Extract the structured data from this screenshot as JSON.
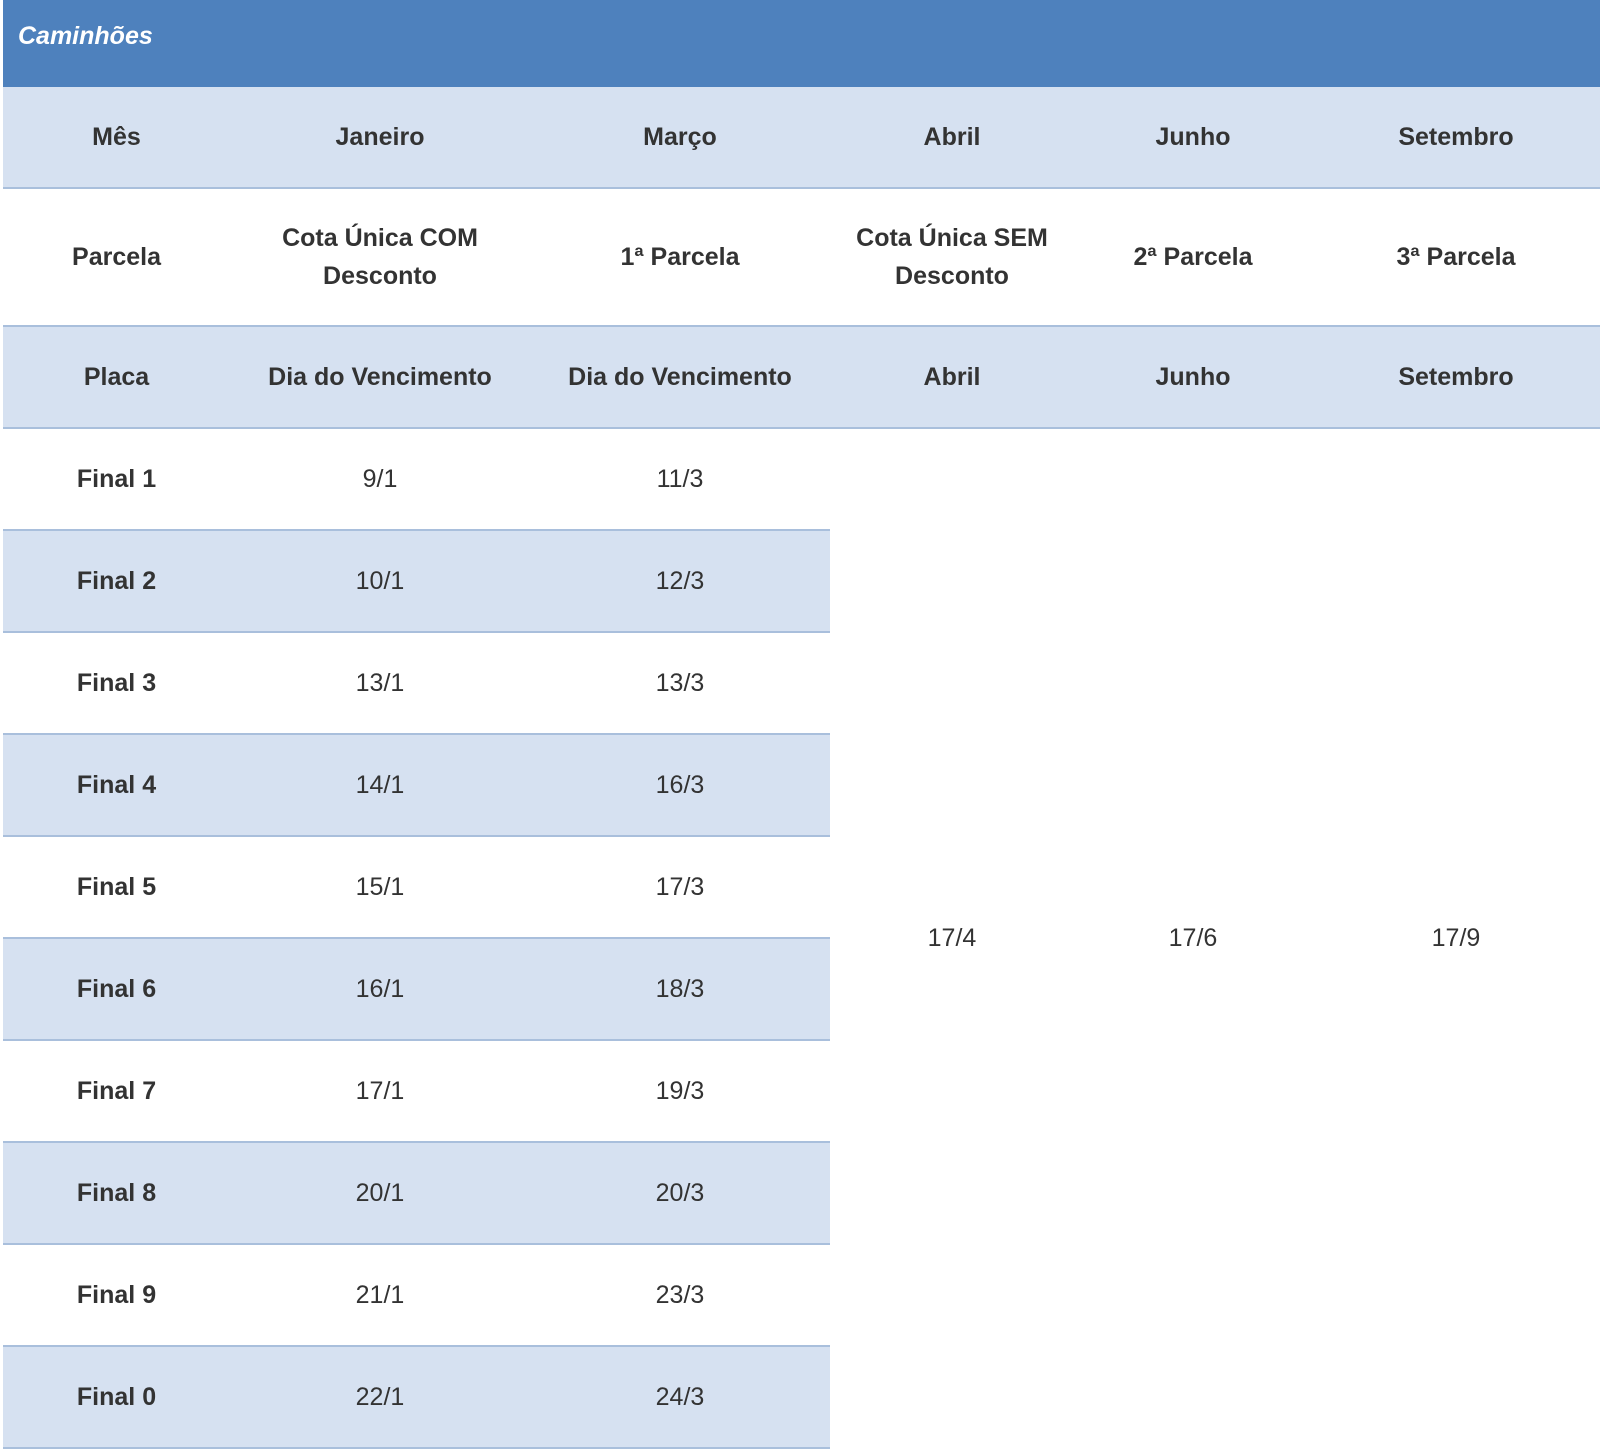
{
  "title": "Caminhões",
  "header_month": [
    "Mês",
    "Janeiro",
    "Março",
    "Abril",
    "Junho",
    "Setembro"
  ],
  "header_parcela": [
    "Parcela",
    "Cota Única COM Desconto",
    "1ª Parcela",
    "Cota Única SEM Desconto",
    "2ª Parcela",
    "3ª Parcela"
  ],
  "header_placa": [
    "Placa",
    "Dia do Vencimento",
    "Dia do Vencimento",
    "Abril",
    "Junho",
    "Setembro"
  ],
  "rows": [
    {
      "placa": "Final 1",
      "janeiro": "9/1",
      "marco": "11/3"
    },
    {
      "placa": "Final 2",
      "janeiro": "10/1",
      "marco": "12/3"
    },
    {
      "placa": "Final 3",
      "janeiro": "13/1",
      "marco": "13/3"
    },
    {
      "placa": "Final 4",
      "janeiro": "14/1",
      "marco": "16/3"
    },
    {
      "placa": "Final 5",
      "janeiro": "15/1",
      "marco": "17/3"
    },
    {
      "placa": "Final 6",
      "janeiro": "16/1",
      "marco": "18/3"
    },
    {
      "placa": "Final 7",
      "janeiro": "17/1",
      "marco": "19/3"
    },
    {
      "placa": "Final 8",
      "janeiro": "20/1",
      "marco": "20/3"
    },
    {
      "placa": "Final 9",
      "janeiro": "21/1",
      "marco": "23/3"
    },
    {
      "placa": "Final 0",
      "janeiro": "22/1",
      "marco": "24/3"
    }
  ],
  "shared_dates": {
    "abril": "17/4",
    "junho": "17/6",
    "setembro": "17/9"
  },
  "colors": {
    "title_bg": "#4e81bd",
    "band_bg": "#d6e1f1",
    "rule": "#a9bfdc",
    "text": "#333333"
  }
}
